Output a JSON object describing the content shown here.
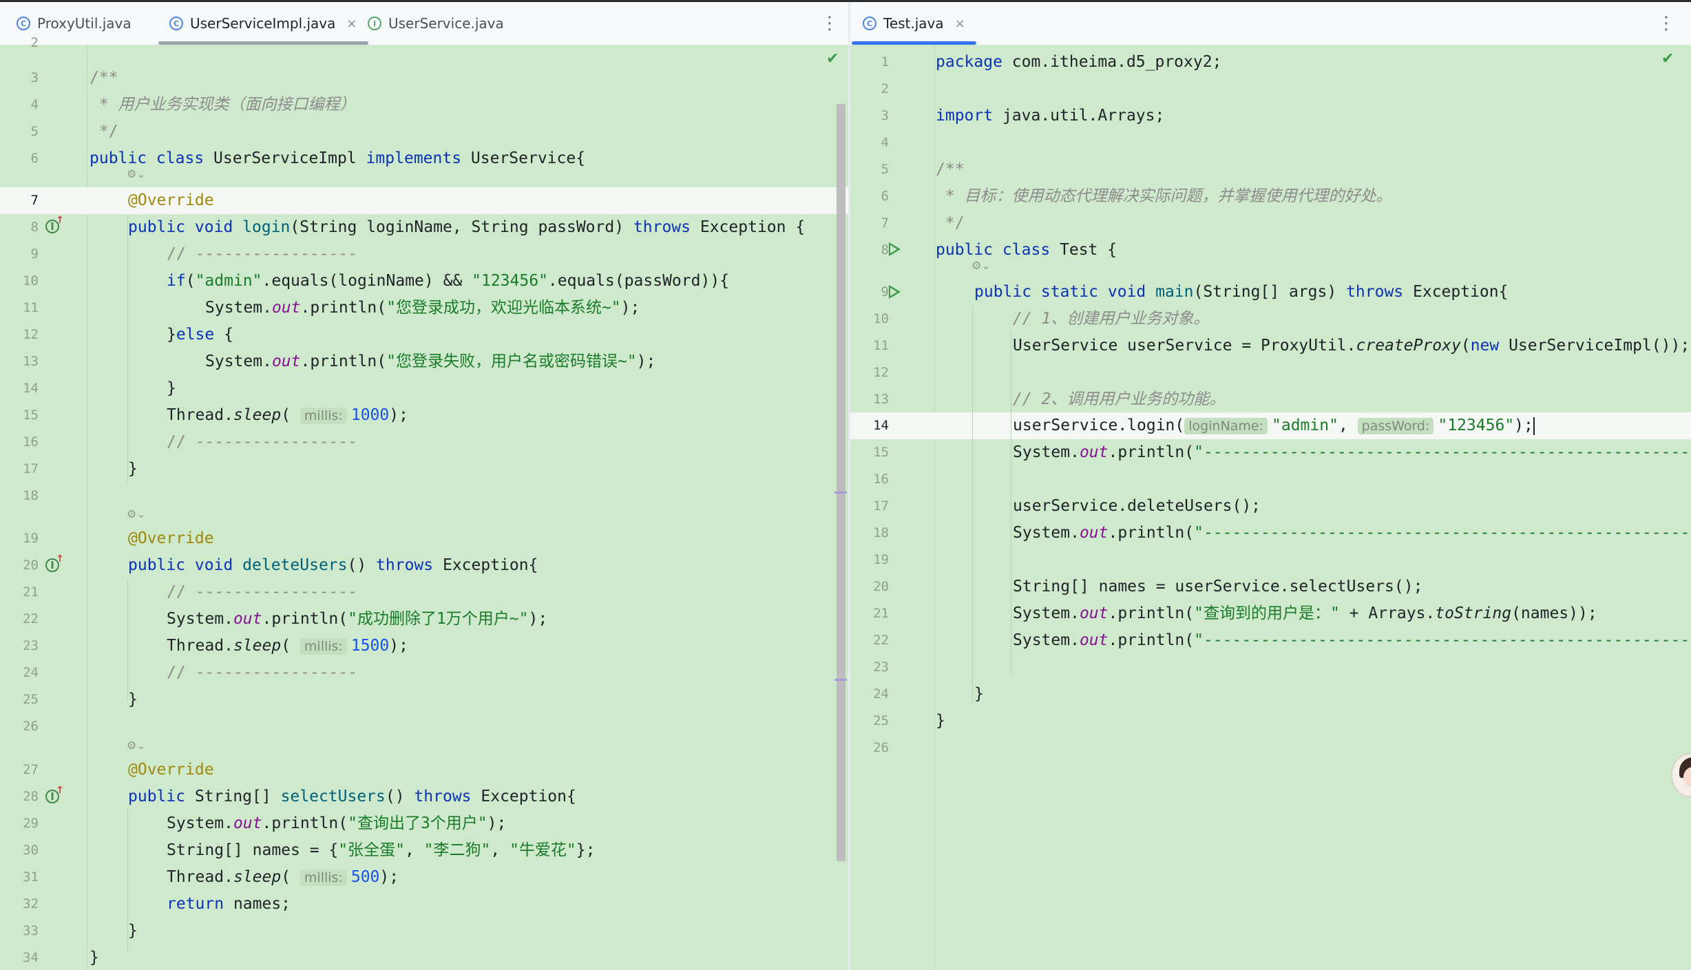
{
  "colors": {
    "editor_bg": "#cfe9cc",
    "tab_bar_bg": "#f7f8fa",
    "active_tab_underline_left": "#9aa3ad",
    "active_tab_underline_right": "#3574f0",
    "keyword": "#0b33b5",
    "string": "#1a7b2a",
    "annotation": "#9e880d",
    "comment": "#8c8c8c",
    "number": "#1750eb",
    "field": "#871094",
    "method_decl": "#00627a"
  },
  "left": {
    "tabs": [
      {
        "label": "ProxyUtil.java",
        "icon": "class-icon"
      },
      {
        "label": "UserServiceImpl.java",
        "icon": "class-icon",
        "active": true
      },
      {
        "label": "UserService.java",
        "icon": "interface-icon"
      }
    ],
    "more_label": "⋮",
    "close_label": "×",
    "hints": {
      "millis": "millis:"
    },
    "line_numbers": [
      "2",
      "3",
      "4",
      "5",
      "6",
      "7",
      "8",
      "9",
      "10",
      "11",
      "12",
      "13",
      "14",
      "15",
      "16",
      "17",
      "18",
      "19",
      "20",
      "21",
      "22",
      "23",
      "24",
      "25",
      "26",
      "27",
      "28",
      "29",
      "30",
      "31",
      "32",
      "33",
      "34"
    ],
    "code": {
      "l3": "/**",
      "l4": " * 用户业务实现类（面向接口编程）",
      "l5": " */",
      "l6a": "public class ",
      "l6b": "UserServiceImpl ",
      "l6c": "implements ",
      "l6d": "UserService{",
      "override": "@Override",
      "l8a": "public void ",
      "l8b": "login",
      "l8c": "(String loginName, String passWord) ",
      "l8d": "throws ",
      "l8e": "Exception {",
      "divider": "// -----------------",
      "l10a": "if",
      "l10b": "(",
      "l10c": "\"admin\"",
      "l10d": ".equals(loginName) && ",
      "l10e": "\"123456\"",
      "l10f": ".equals(passWord)){",
      "sys": "System.",
      "out": "out",
      "println": ".println(",
      "l11s": "\"您登录成功，欢迎光临本系统~\"",
      "end": ");",
      "l12a": "}",
      "l12b": "else ",
      "l12c": "{",
      "l13s": "\"您登录失败，用户名或密码错误~\"",
      "close_brace": "}",
      "thread": "Thread.",
      "sleep": "sleep",
      "paren_open": "(",
      "v1000": "1000",
      "v1500": "1500",
      "v500": "500",
      "l20b": "deleteUsers",
      "l20c": "() ",
      "l20e": "Exception{",
      "l22s": "\"成功删除了1万个用户~\"",
      "l28a": "public ",
      "l28b": "String[] ",
      "l28c": "selectUsers",
      "l28d": "() ",
      "l29s": "\"查询出了3个用户\"",
      "l30a": "String[] names = {",
      "l30b": "\"张全蛋\"",
      "l30c": ", ",
      "l30d": "\"李二狗\"",
      "l30e": "\"牛爱花\"",
      "l30f": "};",
      "l32a": "return ",
      "l32b": "names;"
    }
  },
  "right": {
    "tabs": [
      {
        "label": "Test.java",
        "icon": "class-icon",
        "active": true
      }
    ],
    "more_label": "⋮",
    "close_label": "×",
    "line_numbers": [
      "1",
      "2",
      "3",
      "4",
      "5",
      "6",
      "7",
      "8",
      "9",
      "10",
      "11",
      "12",
      "13",
      "14",
      "15",
      "16",
      "17",
      "18",
      "19",
      "20",
      "21",
      "22",
      "23",
      "24",
      "25",
      "26"
    ],
    "code": {
      "l1a": "package ",
      "l1b": "com.itheima.d5_proxy2;",
      "l3a": "import ",
      "l3b": "java.util.Arrays;",
      "l5": "/**",
      "l6": " * 目标：使用动态代理解决实际问题，并掌握使用代理的好处。",
      "l7": " */",
      "l8a": "public class ",
      "l8b": "Test {",
      "l9a": "public static void ",
      "l9b": "main",
      "l9c": "(String[] args) ",
      "l9d": "throws ",
      "l9e": "Exception{",
      "l10": "// 1、创建用户业务对象。",
      "l11a": "UserService userService = ProxyUtil.",
      "l11b": "createProxy",
      "l11c": "(",
      "l11d": "new ",
      "l11e": "UserServiceImpl());",
      "l13": "// 2、调用用户业务的功能。",
      "l14a": "userService.login(",
      "hint_login": "loginName:",
      "l14b": "\"admin\"",
      "l14c": ", ",
      "hint_pass": "passWord:",
      "l14d": "\"123456\"",
      "l14e": ");",
      "sys": "System.",
      "out": "out",
      "println": ".println(",
      "dashes": "\"--------------------------------------------------------",
      "l17": "userService.deleteUsers();",
      "l20": "String[] names = userService.selectUsers();",
      "l21s": "\"查询到的用户是：\"",
      "l21b": " + Arrays.",
      "l21c": "toString",
      "l21d": "(names));",
      "close_brace": "}"
    }
  }
}
